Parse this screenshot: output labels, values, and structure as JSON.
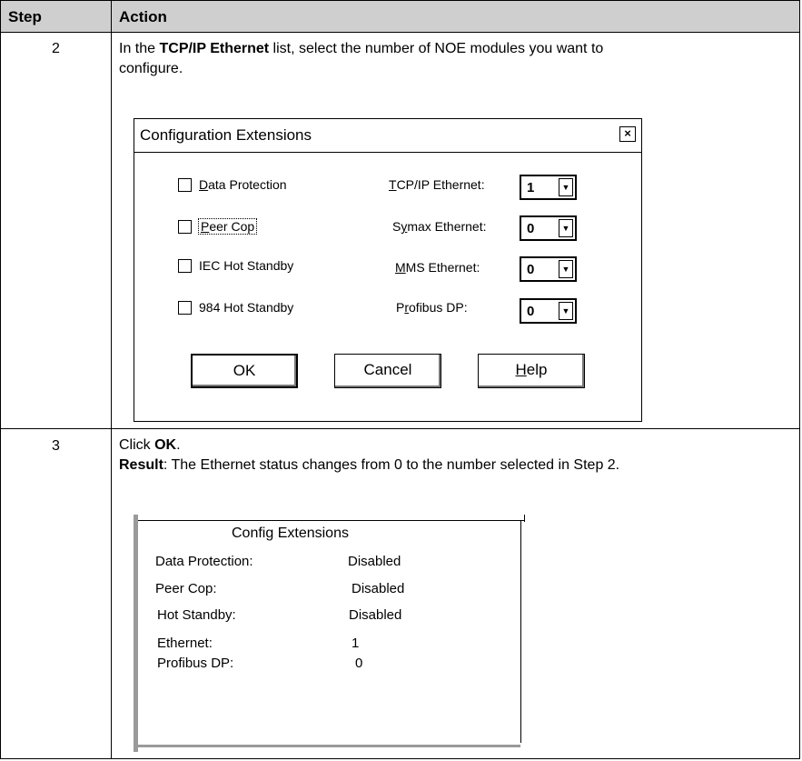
{
  "table": {
    "header_step": "Step",
    "header_action": "Action",
    "rows": [
      {
        "step": "2",
        "text_pre": "In the ",
        "text_bold": "TCP/IP Ethernet",
        "text_post": " list, select the number of NOE modules you want to",
        "text_line2": "configure."
      },
      {
        "step": "3",
        "click_pre": "Click ",
        "click_bold": "OK",
        "click_post": ".",
        "result_bold": "Result",
        "result_text": ": The Ethernet status changes from 0 to the number selected in Step 2."
      }
    ]
  },
  "dialog": {
    "title": "Configuration  Extensions",
    "close": "×",
    "checkboxes": [
      {
        "hot": "D",
        "rest": "ata Protection",
        "checked": false
      },
      {
        "hot": "P",
        "rest": "eer Cop",
        "checked": false
      },
      {
        "label": "IEC Hot Standby",
        "checked": false
      },
      {
        "label": "984 Hot Standby",
        "checked": false
      }
    ],
    "fields": [
      {
        "hot": "T",
        "rest": "CP/IP Ethernet:",
        "value": "1"
      },
      {
        "pre": "S",
        "hot": "y",
        "rest": "max  Ethernet:",
        "value": "0"
      },
      {
        "hot": "M",
        "rest": "MS  Ethernet:",
        "value": "0"
      },
      {
        "pre": "P",
        "hot": "r",
        "rest": "ofibus DP:",
        "value": "0"
      }
    ],
    "dropdown_arrow": "▼",
    "buttons": {
      "ok": "OK",
      "cancel": "Cancel",
      "help_hot": "H",
      "help_rest": "elp"
    }
  },
  "config_box": {
    "title": "Config  Extensions",
    "rows": [
      {
        "label": "Data Protection:",
        "value": "Disabled"
      },
      {
        "label": "Peer Cop:",
        "value": "Disabled"
      },
      {
        "label": "Hot Standby:",
        "value": "Disabled"
      },
      {
        "label": "Ethernet:",
        "value": "1"
      },
      {
        "label": "Profibus DP:",
        "value": "0"
      }
    ]
  }
}
